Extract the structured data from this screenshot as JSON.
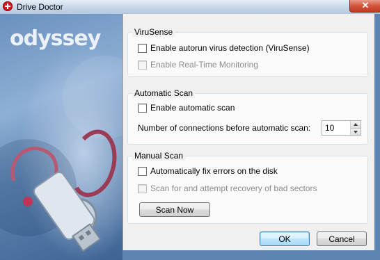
{
  "window": {
    "title": "Drive Doctor",
    "close_glyph": "✕",
    "app_icon": "red-cross-icon"
  },
  "art": {
    "logo": "odyssey"
  },
  "virusense": {
    "legend": "ViruSense",
    "autorun_label": "Enable autorun virus detection (ViruSense)",
    "autorun_checked": false,
    "realtime_label": "Enable Real-Time Monitoring",
    "realtime_checked": false
  },
  "automatic_scan": {
    "legend": "Automatic Scan",
    "enable_label": "Enable automatic scan",
    "enable_checked": false,
    "connections_label": "Number of connections before automatic scan:",
    "connections_value": "10"
  },
  "manual_scan": {
    "legend": "Manual Scan",
    "autofix_label": "Automatically fix errors on the disk",
    "autofix_checked": false,
    "badsectors_label": "Scan for and attempt recovery of bad sectors",
    "badsectors_checked": false,
    "scan_now_label": "Scan Now"
  },
  "footer": {
    "ok_label": "OK",
    "cancel_label": "Cancel"
  },
  "colors": {
    "accent": "#3c7fb1",
    "background": "#5b84b0"
  }
}
